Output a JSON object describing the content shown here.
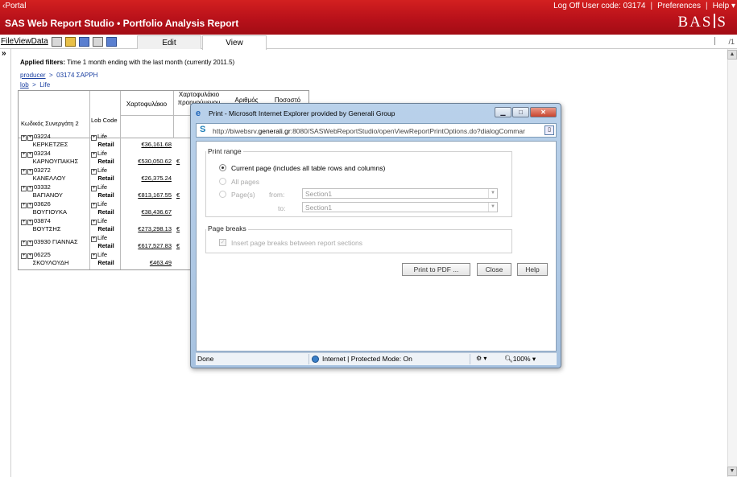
{
  "header": {
    "portal_link": "Portal",
    "app_title": "SAS Web Report Studio  •  Portfolio Analysis Report",
    "logoff": "Log Off User code: 03174",
    "preferences": "Preferences",
    "help": "Help",
    "logo": "BASIS"
  },
  "menu": {
    "file": "File",
    "view": "View",
    "data": "Data"
  },
  "tabs": {
    "edit": "Edit",
    "view": "View"
  },
  "page_indicator": "1",
  "report": {
    "filters_label": "Applied filters:",
    "filters_text": "Time 1 month ending with the last month (currently 2011.5)",
    "breadcrumb1": {
      "a": "producer",
      "sep": ">",
      "b": "03174 ΣΑΡΡΗ"
    },
    "breadcrumb2": {
      "a": "lob",
      "sep": ">",
      "b": "Life"
    },
    "columns": {
      "partner_code": "Κωδικός Συνεργάτη 2",
      "lob_code": "Lob Code",
      "portfolio": "Χαρτοφυλάκιο",
      "portfolio_prev_1": "Χαρτοφυλάκιο",
      "portfolio_prev_2": "προηγούμενου",
      "count": "Αριθμός",
      "percent": "Ποσοστό"
    },
    "rows": [
      {
        "code": "03224",
        "name": "ΚΕΡΚΕΤΖΕΣ",
        "lob": "Life",
        "lob2": "Retail",
        "value": "€36,161.68",
        "cut": ""
      },
      {
        "code": "03234",
        "name": "ΚΑΡΝΟΥΠΑΚΗΣ",
        "lob": "Life",
        "lob2": "Retail",
        "value": "€530,050.62",
        "cut": "€"
      },
      {
        "code": "03272",
        "name": "ΚΑΝΕΛΛΟΥ",
        "lob": "Life",
        "lob2": "Retail",
        "value": "€26,375.24",
        "cut": ""
      },
      {
        "code": "03332",
        "name": "ΒΑΓΙΑΝΟΥ",
        "lob": "Life",
        "lob2": "Retail",
        "value": "€813,167.55",
        "cut": "€"
      },
      {
        "code": "03626",
        "name": "ΒΟΥΓΙΟΥΚΑ",
        "lob": "Life",
        "lob2": "Retail",
        "value": "€38,436.67",
        "cut": ""
      },
      {
        "code": "03874",
        "name": "ΒΟΥΤΣΗΣ",
        "lob": "Life",
        "lob2": "Retail",
        "value": "€273,298.13",
        "cut": "€"
      },
      {
        "code": "03930",
        "name": "ΓΙΑΝΝΑΣ",
        "lob": "Life",
        "lob2": "Retail",
        "value": "€617,527.83",
        "cut": "€"
      },
      {
        "code": "06225",
        "name": "ΣΚΟΥΛΟΥΔΗ",
        "lob": "Life",
        "lob2": "Retail",
        "value": "€463.49",
        "cut": ""
      }
    ]
  },
  "dialog": {
    "title": "Print - Microsoft Internet Explorer provided by Generali Group",
    "url_prefix": "http://biwebsrv.",
    "url_domain": "generali.gr",
    "url_suffix": ":8080/SASWebReportStudio/openViewReportPrintOptions.do?dialogCommar",
    "print_range_legend": "Print range",
    "opt_current": "Current page (includes all table rows and columns)",
    "opt_all": "All pages",
    "opt_pages": "Page(s)",
    "from_label": "from:",
    "to_label": "to:",
    "from_value": "Section1",
    "to_value": "Section1",
    "page_breaks_legend": "Page breaks",
    "insert_breaks": "Insert page breaks between report sections",
    "btn_pdf": "Print to PDF ...",
    "btn_close": "Close",
    "btn_help": "Help",
    "status_done": "Done",
    "status_zone": "Internet | Protected Mode: On",
    "zoom": "100%"
  }
}
